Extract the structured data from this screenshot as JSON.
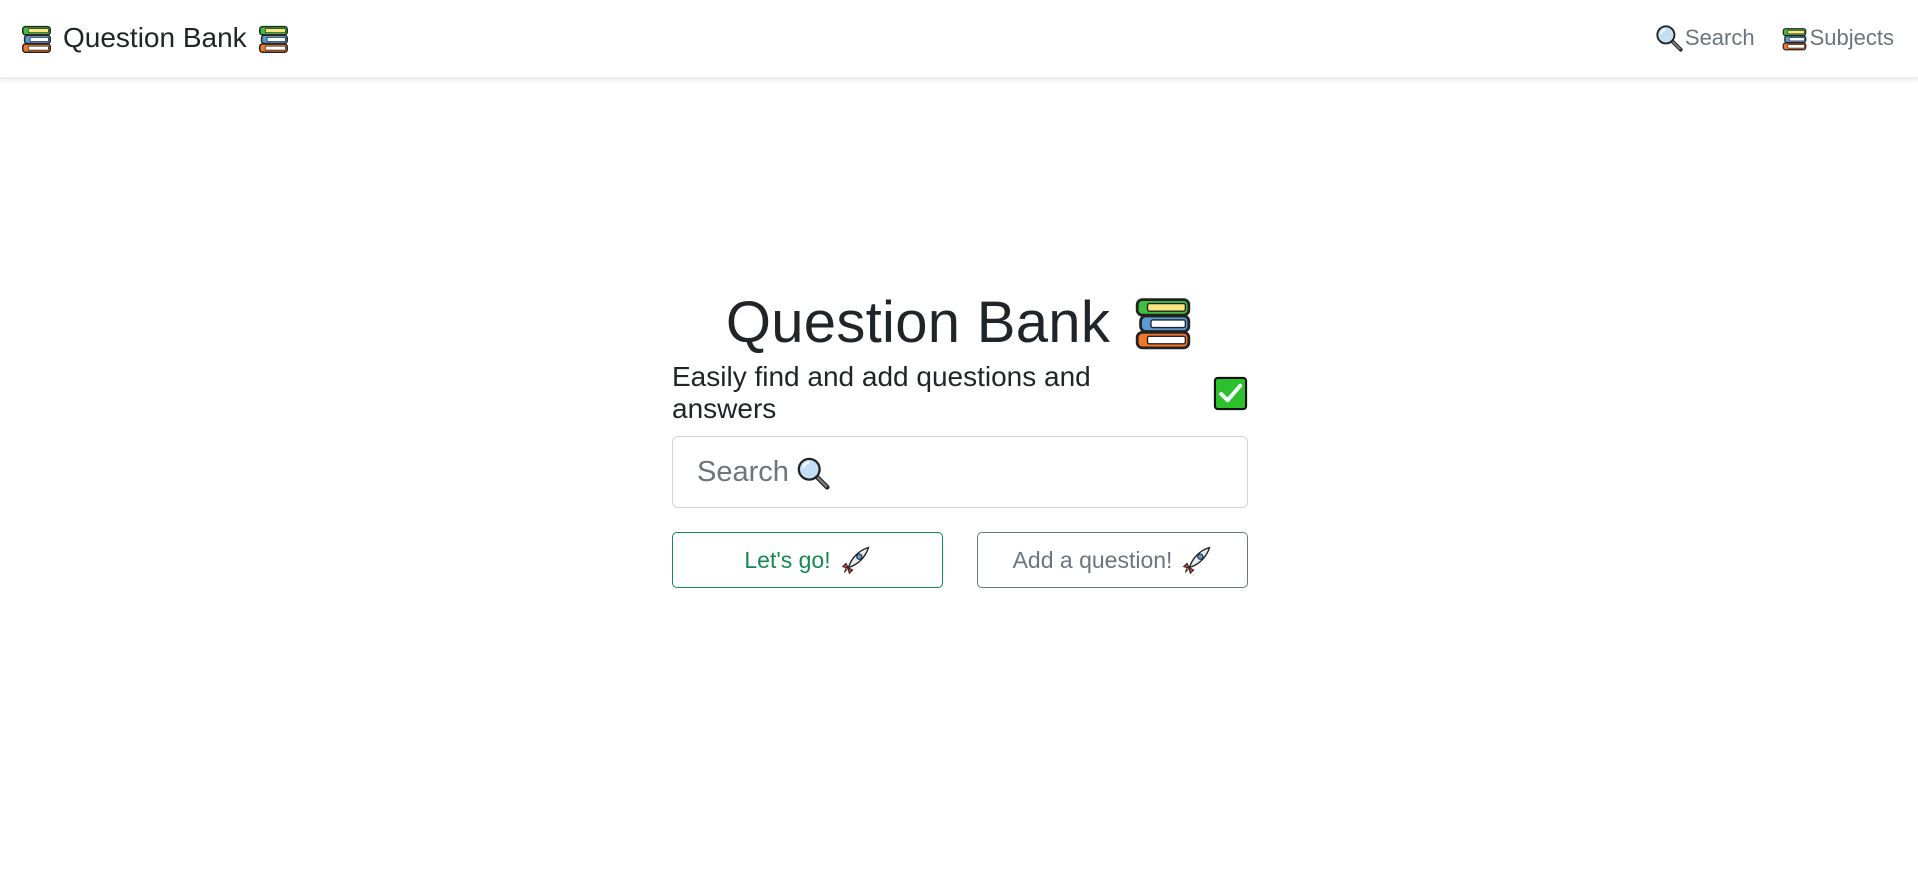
{
  "navbar": {
    "brand": {
      "text": "Question Bank",
      "icon_left": "books-icon",
      "icon_right": "books-icon"
    },
    "links": [
      {
        "label": "Search",
        "icon": "magnifier-icon"
      },
      {
        "label": "Subjects",
        "icon": "books-icon"
      }
    ]
  },
  "hero": {
    "title": "Question Bank",
    "title_icon": "books-icon",
    "subtitle": "Easily find and add questions and answers",
    "subtitle_icon": "check-mark-button-icon"
  },
  "search": {
    "placeholder": "Search",
    "placeholder_icon": "magnifier-icon",
    "value": ""
  },
  "buttons": {
    "go_label": "Let's go!",
    "go_icon": "rocket-icon",
    "add_label": "Add a question!",
    "add_icon": "rocket-icon"
  },
  "colors": {
    "success": "#198754",
    "secondary": "#6c757d",
    "text": "#212529",
    "border": "#ced4da"
  }
}
